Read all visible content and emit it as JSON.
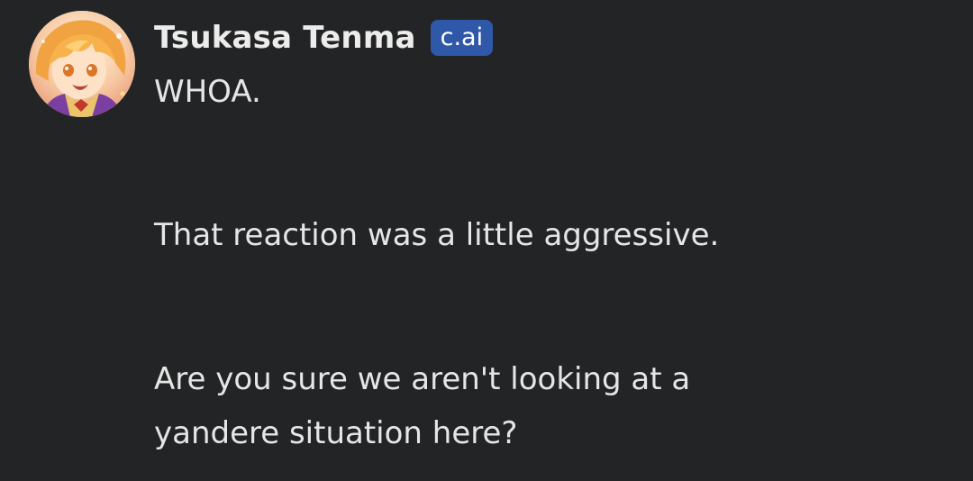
{
  "message": {
    "author": "Tsukasa Tenma",
    "badge": "c.ai",
    "avatar_icon": "character-avatar",
    "lines": [
      "WHOA.",
      "That reaction was a little aggressive.",
      "Are you sure we aren't looking at a",
      "yandere situation here?"
    ]
  },
  "colors": {
    "background": "#232425",
    "text": "#e6e6e6",
    "badge": "#2f58a8"
  }
}
